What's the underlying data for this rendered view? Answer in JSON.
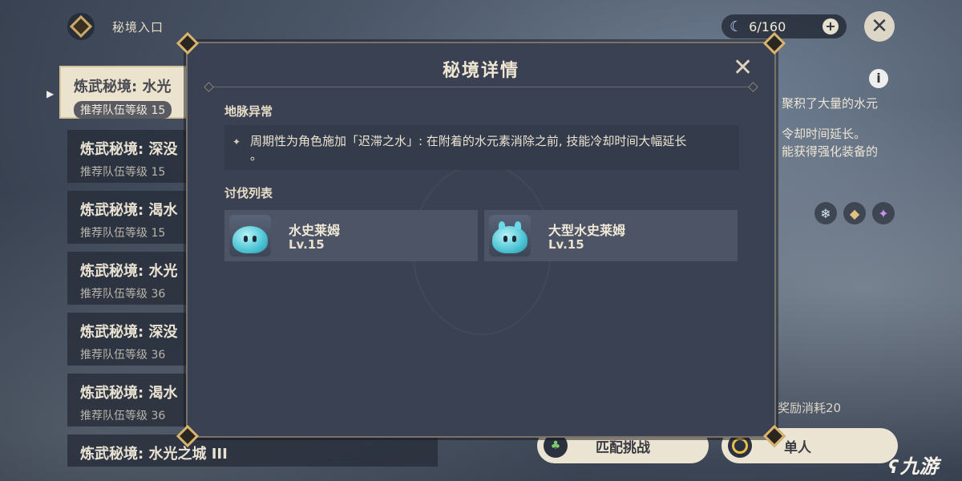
{
  "header": {
    "title": "秘境入口",
    "resin_value": "6/160",
    "resin_plus": "+",
    "close_glyph": "✕"
  },
  "domain_list": {
    "items": [
      {
        "name": "炼武秘境: 水光",
        "level": "推荐队伍等级 15",
        "selected": true
      },
      {
        "name": "炼武秘境: 深没",
        "level": "推荐队伍等级 15"
      },
      {
        "name": "炼武秘境: 渴水",
        "level": "推荐队伍等级 15"
      },
      {
        "name": "炼武秘境: 水光",
        "level": "推荐队伍等级 36"
      },
      {
        "name": "炼武秘境: 深没",
        "level": "推荐队伍等级 36"
      },
      {
        "name": "炼武秘境: 渴水",
        "level": "推荐队伍等级 36"
      },
      {
        "name": "炼武秘境: 水光之城 III",
        "level": ""
      }
    ]
  },
  "right_panel": {
    "info_glyph": "i",
    "desc_line1": "聚积了大量的水元",
    "desc_line2": "令却时间延长。",
    "desc_line3": "能获得强化装备的",
    "reward_cost": "奖励消耗20",
    "match_label": "匹配挑战",
    "single_label": "单人"
  },
  "modal": {
    "title": "秘境详情",
    "close_glyph": "✕",
    "anomaly_heading": "地脉异常",
    "anomaly_text_line1": "周期性为角色施加「迟滞之水」: 在附着的水元素消除之前, 技能冷却时间大幅延长",
    "anomaly_text_line2": "。",
    "enemy_heading": "讨伐列表",
    "enemies": [
      {
        "name": "水史莱姆",
        "level": "Lv.15"
      },
      {
        "name": "大型水史莱姆",
        "level": "Lv.15"
      }
    ]
  },
  "watermark": "九游",
  "colors": {
    "modal_bg": "#3a4152",
    "accent_gold": "#d8b470",
    "button_bg": "#ece4d2"
  },
  "icons": [
    "diamond-icon",
    "moon-icon",
    "plus-icon",
    "close-icon",
    "info-icon",
    "hydro-slime-icon",
    "large-hydro-slime-icon",
    "match-icon",
    "single-icon",
    "sparkle-icon"
  ]
}
